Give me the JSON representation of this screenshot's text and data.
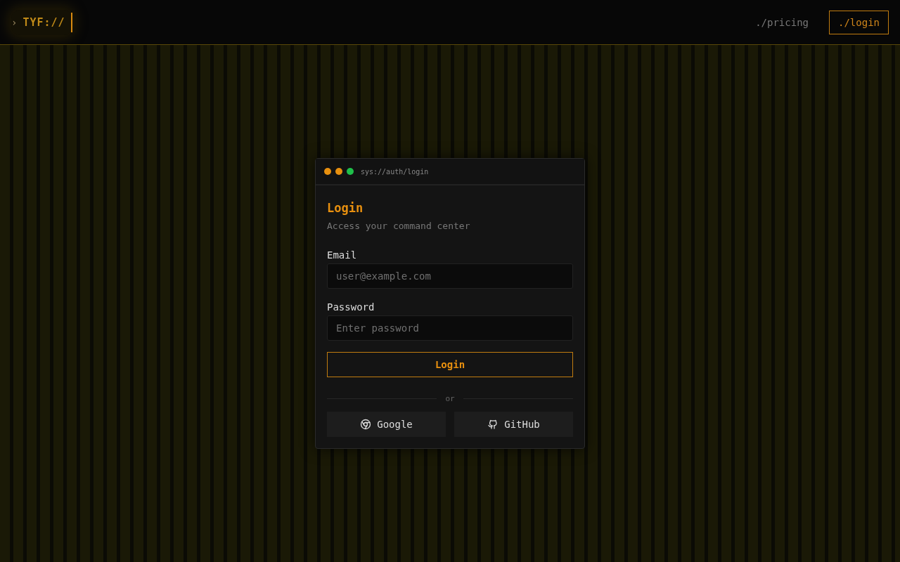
{
  "header": {
    "logo_prompt": "›",
    "logo": "TYF://",
    "nav": [
      {
        "label": "./pricing",
        "selected": false
      },
      {
        "label": "./login",
        "selected": true
      }
    ]
  },
  "window": {
    "dots": [
      {
        "color": "#e8900f"
      },
      {
        "color": "#e8900f"
      },
      {
        "color": "#1fbf4a"
      }
    ],
    "title": "sys://auth/login"
  },
  "form": {
    "heading": "Login",
    "subtitle": "Access your command center",
    "fields": [
      {
        "label": "Email",
        "placeholder": "user@example.com"
      },
      {
        "label": "Password",
        "placeholder": "Enter password"
      }
    ],
    "submit": "Login",
    "divider": "or",
    "providers": [
      {
        "label": "Google",
        "kind": "google"
      },
      {
        "label": "GitHub",
        "kind": "github"
      }
    ]
  }
}
